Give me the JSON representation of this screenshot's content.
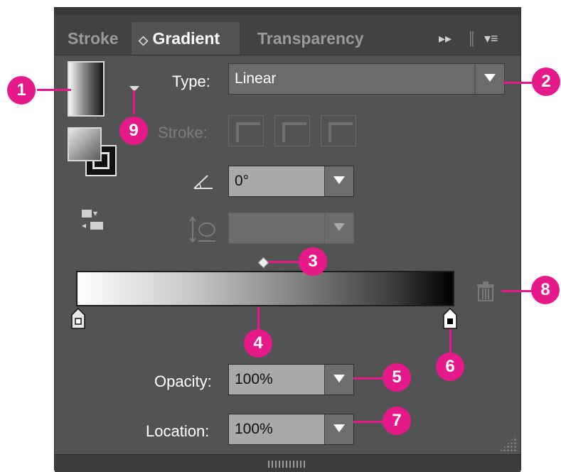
{
  "tabs": {
    "stroke": "Stroke",
    "gradient_arrows": "◇",
    "gradient": "Gradient",
    "transparency": "Transparency",
    "menu_forward": "▸▸",
    "menu_sep": "║",
    "menu_list": "▾≡"
  },
  "type": {
    "label": "Type:",
    "value": "Linear"
  },
  "stroke": {
    "label": "Stroke:"
  },
  "angle": {
    "value": "0°"
  },
  "aspect": {
    "value": ""
  },
  "opacity": {
    "label": "Opacity:",
    "value": "100%"
  },
  "location": {
    "label": "Location:",
    "value": "100%"
  },
  "callouts": {
    "c1": "1",
    "c2": "2",
    "c3": "3",
    "c4": "4",
    "c5": "5",
    "c6": "6",
    "c7": "7",
    "c8": "8",
    "c9": "9"
  },
  "colors": {
    "callout": "#e6198b",
    "panel": "#535353",
    "tabbar": "#424242"
  },
  "icons": [
    "gradient-swatch-icon",
    "fill-stroke-icon",
    "reverse-gradient-icon",
    "angle-icon",
    "aspect-ratio-icon",
    "trash-icon",
    "midpoint-diamond-icon",
    "color-stop-icon"
  ]
}
